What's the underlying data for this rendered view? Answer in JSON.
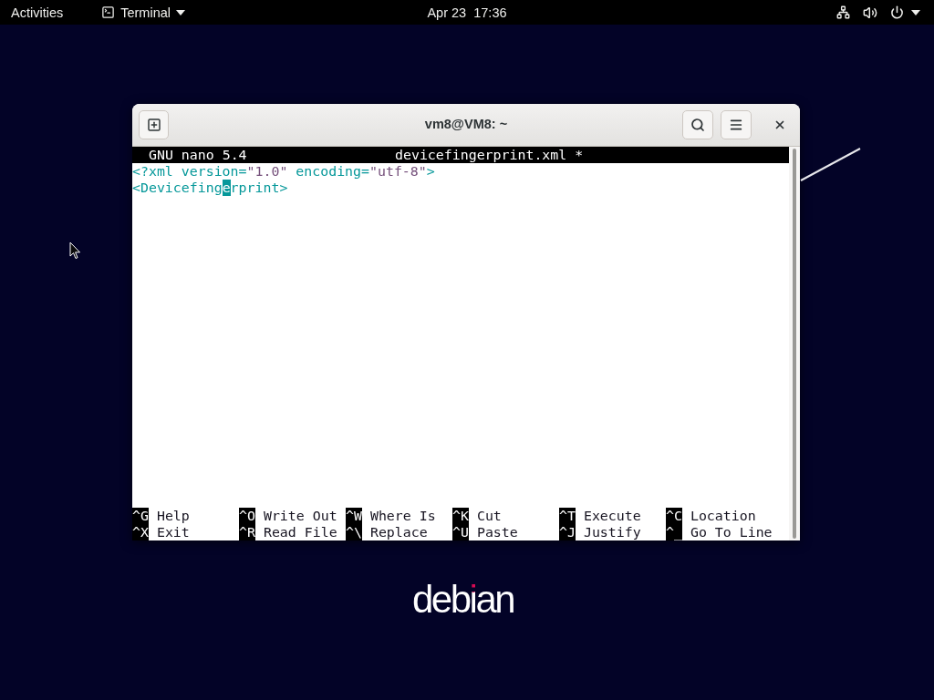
{
  "top_bar": {
    "activities": "Activities",
    "app_menu": "Terminal",
    "clock": "Apr 23  17:36"
  },
  "window": {
    "title": "vm8@VM8: ~"
  },
  "nano": {
    "version": "GNU nano 5.4",
    "filename": "devicefingerprint.xml *",
    "lines": [
      [
        {
          "text": "<?xml version=",
          "kind": "tag"
        },
        {
          "text": "\"1.0\"",
          "kind": "string"
        },
        {
          "text": " encoding=",
          "kind": "tag"
        },
        {
          "text": "\"utf-8\"",
          "kind": "string"
        },
        {
          "text": ">",
          "kind": "tag"
        }
      ],
      [
        {
          "text": "<Devicefing",
          "kind": "tag"
        },
        {
          "text": "e",
          "kind": "cursor"
        },
        {
          "text": "rprint>",
          "kind": "tag"
        }
      ]
    ],
    "shortcuts": [
      [
        {
          "key": "^G",
          "label": "Help"
        },
        {
          "key": "^O",
          "label": "Write Out"
        },
        {
          "key": "^W",
          "label": "Where Is"
        },
        {
          "key": "^K",
          "label": "Cut"
        },
        {
          "key": "^T",
          "label": "Execute"
        },
        {
          "key": "^C",
          "label": "Location"
        }
      ],
      [
        {
          "key": "^X",
          "label": "Exit"
        },
        {
          "key": "^R",
          "label": "Read File"
        },
        {
          "key": "^\\",
          "label": "Replace"
        },
        {
          "key": "^U",
          "label": "Paste"
        },
        {
          "key": "^J",
          "label": "Justify"
        },
        {
          "key": "^_",
          "label": "Go To Line"
        }
      ]
    ]
  },
  "desktop": {
    "logo": "debian"
  }
}
